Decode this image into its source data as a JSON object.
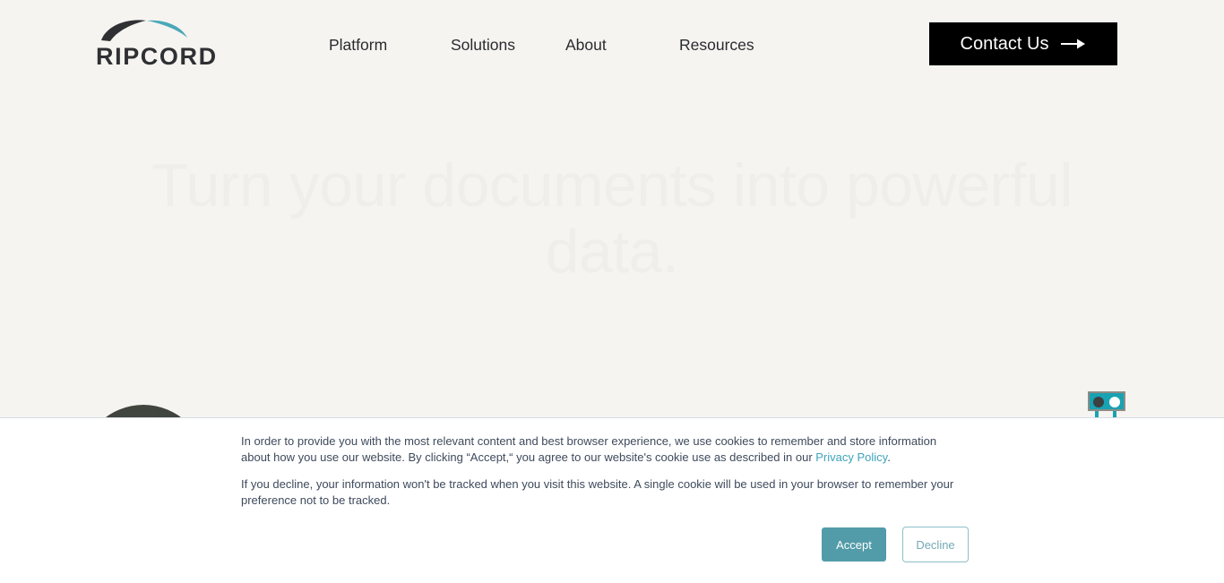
{
  "colors": {
    "page_background": "#f5f4f0",
    "brand_teal": "#3fa3bb",
    "accept_teal": "#529ba8",
    "decline_border": "#8dbfc8",
    "logo_dark": "#2f3033",
    "logo_teal": "#4ba8b8",
    "contact_button_bg": "#000000",
    "hero_text": "#efeeea",
    "banner_bg": "#ffffff",
    "banner_text": "#3e4a5c"
  },
  "header": {
    "logo": {
      "wordmark": "RIPCORD",
      "canopy_icon": "parachute-canopy-icon"
    },
    "nav": [
      {
        "label": "Platform"
      },
      {
        "label": "Solutions"
      },
      {
        "label": "About"
      },
      {
        "label": "Resources"
      }
    ],
    "contact_button": {
      "label": "Contact Us",
      "icon": "arrow-right-icon"
    }
  },
  "hero": {
    "title": "Turn your documents into powerful data."
  },
  "decor": {
    "dark_dome": "dark-dome-shape",
    "robot": "robot-graphic"
  },
  "cookie_banner": {
    "paragraph_1_before_link": "In order to provide you with the most relevant content and best browser experience, we use cookies to remember and store information about how you use our website. By clicking “Accept,“ you agree to our website's cookie use as described in our ",
    "privacy_link_label": "Privacy Policy",
    "paragraph_1_after_link": ".",
    "paragraph_2": "If you decline, your information won't be tracked when you visit this website. A single cookie will be used in your browser to remember your preference not to be tracked.",
    "accept_label": "Accept",
    "decline_label": "Decline"
  }
}
